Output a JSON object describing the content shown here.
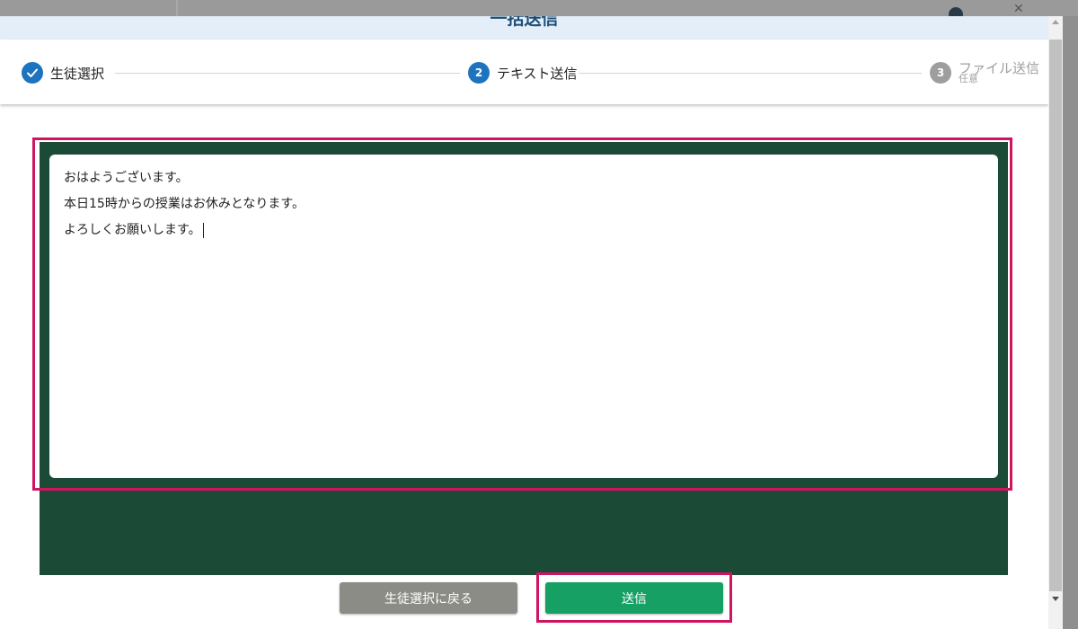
{
  "modal": {
    "title": "一括送信"
  },
  "stepper": {
    "steps": [
      {
        "number": "1",
        "label": "生徒選択",
        "state": "completed"
      },
      {
        "number": "2",
        "label": "テキスト送信",
        "state": "active"
      },
      {
        "number": "3",
        "label": "ファイル送信",
        "sublabel": "任意",
        "state": "inactive"
      }
    ]
  },
  "editor": {
    "lines": [
      "おはようございます。",
      "本日15時からの授業はお休みとなります。",
      "よろしくお願いします。"
    ]
  },
  "footer": {
    "back_label": "生徒選択に戻る",
    "send_label": "送信"
  },
  "colors": {
    "accent_blue": "#1e73be",
    "send_green": "#16a064",
    "back_gray": "#8c8c86",
    "editor_frame": "#1b4a36",
    "highlight": "#d01462"
  }
}
